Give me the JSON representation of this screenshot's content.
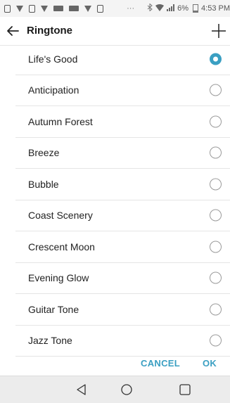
{
  "status_bar": {
    "overflow_dots": "···",
    "battery_percent": "6%",
    "time": "4:53 PM"
  },
  "header": {
    "title": "Ringtone",
    "back_icon": "arrow-left",
    "add_icon": "plus"
  },
  "ringtones": {
    "items": [
      {
        "label": "Life's Good",
        "selected": true
      },
      {
        "label": "Anticipation",
        "selected": false
      },
      {
        "label": "Autumn Forest",
        "selected": false
      },
      {
        "label": "Breeze",
        "selected": false
      },
      {
        "label": "Bubble",
        "selected": false
      },
      {
        "label": "Coast Scenery",
        "selected": false
      },
      {
        "label": "Crescent Moon",
        "selected": false
      },
      {
        "label": "Evening Glow",
        "selected": false
      },
      {
        "label": "Guitar Tone",
        "selected": false
      },
      {
        "label": "Jazz Tone",
        "selected": false
      }
    ]
  },
  "actions": {
    "cancel_label": "CANCEL",
    "ok_label": "OK"
  },
  "colors": {
    "accent": "#3a9fc2",
    "status_bar_bg": "#f4f4f4",
    "nav_bar_bg": "#ececec"
  }
}
